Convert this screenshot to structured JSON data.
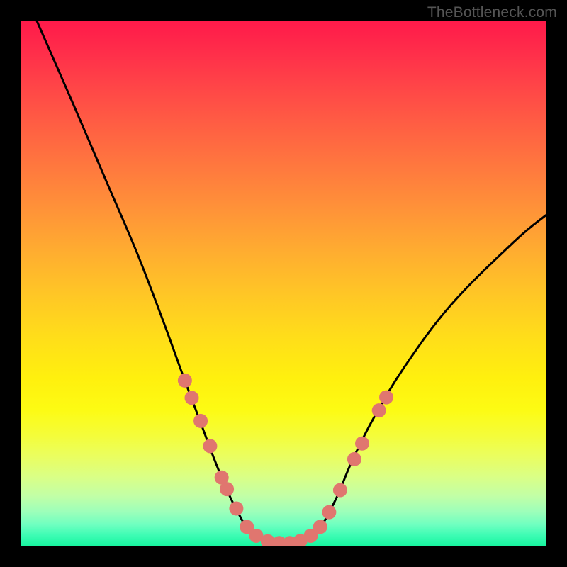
{
  "watermark": "TheBottleneck.com",
  "chart_data": {
    "type": "line",
    "title": "",
    "xlabel": "",
    "ylabel": "",
    "xlim": [
      0,
      100
    ],
    "ylim": [
      0,
      100
    ],
    "grid": false,
    "legend": false,
    "series": [
      {
        "name": "curve",
        "x": [
          3,
          10,
          16,
          22,
          27,
          31,
          34,
          37,
          39.5,
          41.5,
          43,
          45,
          48,
          52,
          55,
          57,
          58.5,
          60.5,
          63,
          67,
          73,
          82,
          94,
          100
        ],
        "values": [
          100,
          84,
          70,
          56,
          43,
          32,
          24,
          16,
          10,
          6,
          3.5,
          1.7,
          0.6,
          0.6,
          1.7,
          3.5,
          6,
          10,
          16,
          24,
          34,
          46,
          58,
          63
        ]
      }
    ],
    "markers": [
      {
        "x": 31.2,
        "y": 31.5
      },
      {
        "x": 32.5,
        "y": 28.2
      },
      {
        "x": 34.2,
        "y": 23.8
      },
      {
        "x": 36.0,
        "y": 19.0
      },
      {
        "x": 38.2,
        "y": 13.0
      },
      {
        "x": 39.2,
        "y": 10.8
      },
      {
        "x": 41.0,
        "y": 7.1
      },
      {
        "x": 43.0,
        "y": 3.6
      },
      {
        "x": 44.8,
        "y": 1.9
      },
      {
        "x": 47.0,
        "y": 0.85
      },
      {
        "x": 49.2,
        "y": 0.5
      },
      {
        "x": 51.2,
        "y": 0.5
      },
      {
        "x": 53.2,
        "y": 0.9
      },
      {
        "x": 55.2,
        "y": 1.9
      },
      {
        "x": 57.0,
        "y": 3.6
      },
      {
        "x": 58.7,
        "y": 6.4
      },
      {
        "x": 60.8,
        "y": 10.6
      },
      {
        "x": 63.5,
        "y": 16.5
      },
      {
        "x": 65.0,
        "y": 19.5
      },
      {
        "x": 68.2,
        "y": 25.8
      },
      {
        "x": 69.6,
        "y": 28.3
      }
    ],
    "marker_color": "#e0766f",
    "marker_radius_px": 10,
    "curve_stroke": "#000000",
    "curve_stroke_width_px": 3
  }
}
